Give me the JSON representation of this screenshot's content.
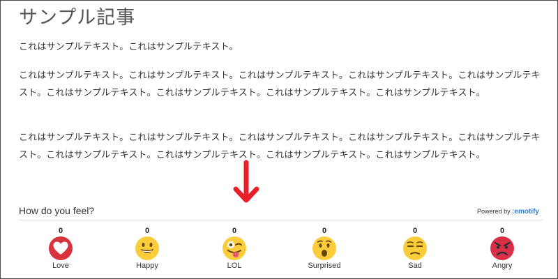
{
  "article": {
    "title": "サンプル記事",
    "paragraphs": [
      "これはサンプルテキスト。これはサンプルテキスト。",
      "これはサンプルテキスト。これはサンプルテキスト。これはサンプルテキスト。これはサンプルテキスト。これはサンプルテキスト。これはサンプルテキスト。これはサンプルテキスト。これはサンプルテキスト。これはサンプルテキスト。",
      "これはサンプルテキスト。これはサンプルテキスト。これはサンプルテキスト。これはサンプルテキスト。これはサンプルテキスト。これはサンプルテキスト。これはサンプルテキスト。これはサンプルテキスト。これはサンプルテキスト。"
    ]
  },
  "annotation": {
    "icon": "down-arrow-icon",
    "color": "#e8202a"
  },
  "reactions_widget": {
    "prompt": "How do you feel?",
    "powered_by": "Powered by",
    "brand": ":emotify",
    "items": [
      {
        "label": "Love",
        "count": "0",
        "icon": "heart-icon"
      },
      {
        "label": "Happy",
        "count": "0",
        "icon": "smile-icon"
      },
      {
        "label": "LOL",
        "count": "0",
        "icon": "wink-tongue-icon"
      },
      {
        "label": "Surprised",
        "count": "0",
        "icon": "surprised-icon"
      },
      {
        "label": "Sad",
        "count": "0",
        "icon": "unamused-icon"
      },
      {
        "label": "Angry",
        "count": "0",
        "icon": "angry-icon"
      }
    ]
  }
}
